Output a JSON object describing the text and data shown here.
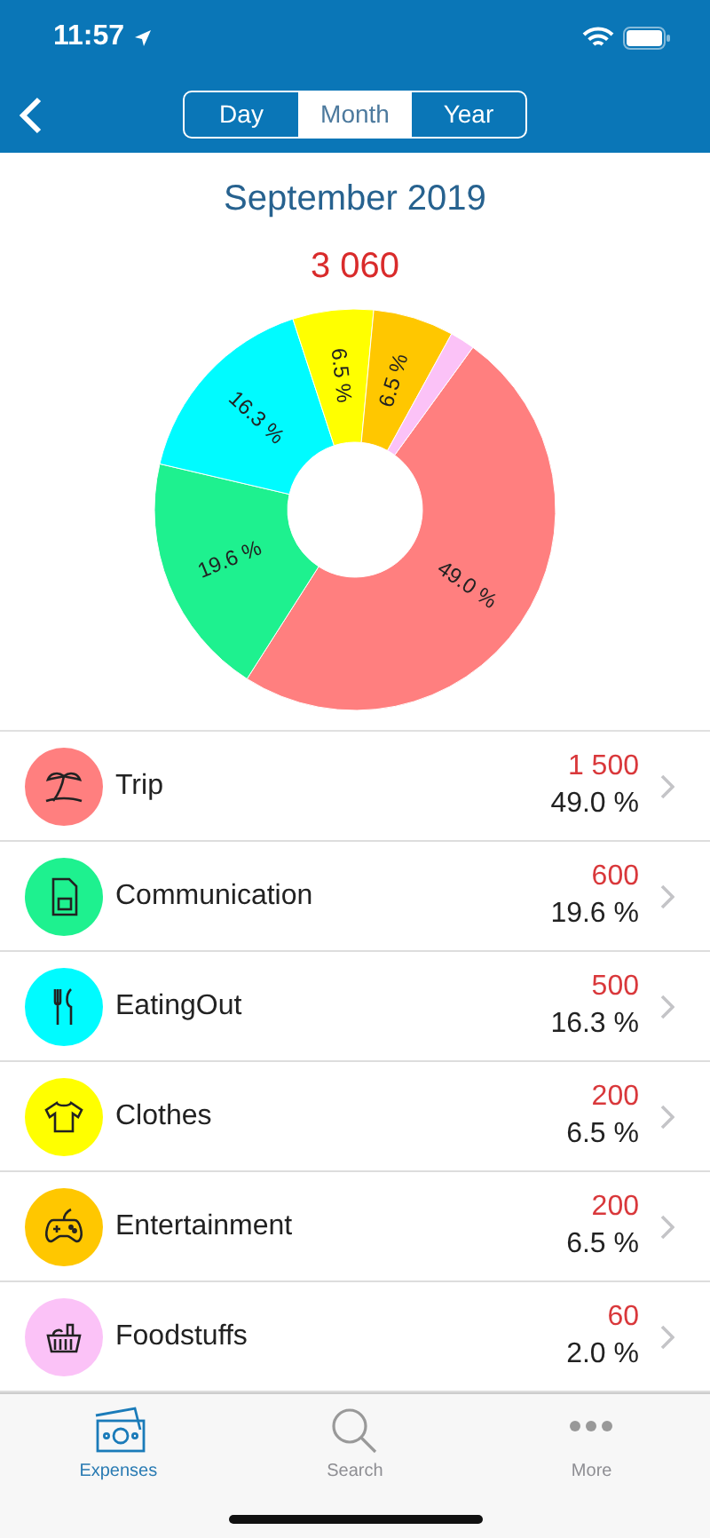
{
  "status_bar": {
    "time": "11:57"
  },
  "nav": {
    "segments": [
      {
        "label": "Day",
        "selected": false
      },
      {
        "label": "Month",
        "selected": true
      },
      {
        "label": "Year",
        "selected": false
      }
    ]
  },
  "header": {
    "period": "September 2019",
    "total": "3 060"
  },
  "chart_data": {
    "type": "donut",
    "values": [
      49.0,
      19.6,
      16.3,
      6.5,
      6.5,
      2.0
    ],
    "colors": [
      "#ff7f7f",
      "#1ef18f",
      "#00fbff",
      "#ffff00",
      "#ffc700",
      "#fbc2f7"
    ],
    "value_labels": [
      "49.0 %",
      "19.6 %",
      "16.3 %",
      "6.5 %",
      "6.5 %",
      null
    ]
  },
  "categories": [
    {
      "name": "Trip",
      "amount": "1 500",
      "percent": "49.0 %",
      "color": "#ff7f7f",
      "kind": "palm"
    },
    {
      "name": "Communication",
      "amount": "600",
      "percent": "19.6 %",
      "color": "#1ef18f",
      "kind": "sim"
    },
    {
      "name": "EatingOut",
      "amount": "500",
      "percent": "16.3 %",
      "color": "#00fbff",
      "kind": "cutlery"
    },
    {
      "name": "Clothes",
      "amount": "200",
      "percent": "6.5 %",
      "color": "#ffff00",
      "kind": "shirt"
    },
    {
      "name": "Entertainment",
      "amount": "200",
      "percent": "6.5 %",
      "color": "#ffc700",
      "kind": "gamepad"
    },
    {
      "name": "Foodstuffs",
      "amount": "60",
      "percent": "2.0 %",
      "color": "#fbc2f7",
      "kind": "basket"
    }
  ],
  "tab_bar": [
    {
      "label": "Expenses",
      "selected": true,
      "kind": "money"
    },
    {
      "label": "Search",
      "selected": false,
      "kind": "search"
    },
    {
      "label": "More",
      "selected": false,
      "kind": "more"
    }
  ]
}
